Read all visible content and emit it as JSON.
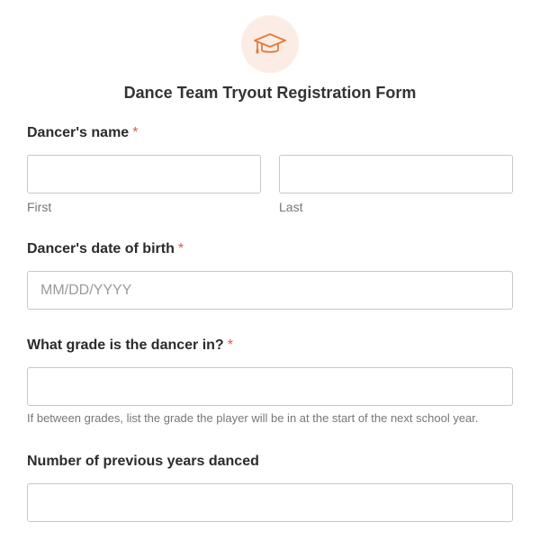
{
  "header": {
    "icon": "graduation-cap-icon",
    "accent_color": "#e5793b",
    "icon_bg_color": "#fbede5",
    "title": "Dance Team Tryout Registration Form"
  },
  "fields": {
    "name": {
      "label": "Dancer's name",
      "required_mark": "*",
      "first": {
        "value": "",
        "sublabel": "First"
      },
      "last": {
        "value": "",
        "sublabel": "Last"
      }
    },
    "dob": {
      "label": "Dancer's date of birth",
      "required_mark": "*",
      "value": "",
      "placeholder": "MM/DD/YYYY"
    },
    "grade": {
      "label": "What grade is the dancer in?",
      "required_mark": "*",
      "value": "",
      "help": "If between grades, list the grade the player will be in at the start of the next school year."
    },
    "years": {
      "label": "Number of previous years danced",
      "value": ""
    }
  },
  "colors": {
    "required": "#e05a4f",
    "border": "#c7c7c7"
  }
}
